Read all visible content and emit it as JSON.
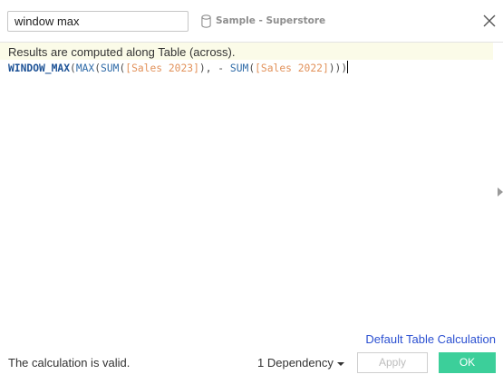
{
  "header": {
    "calc_name": "window max",
    "datasource_icon": "database-icon",
    "datasource_name": "Sample - Superstore",
    "close_icon": "close-icon"
  },
  "info": {
    "message": "Results are computed along Table (across)."
  },
  "formula": {
    "tokens": [
      {
        "text": "WINDOW_MAX",
        "kind": "fn-bold"
      },
      {
        "text": "(",
        "kind": "punct"
      },
      {
        "text": "MAX",
        "kind": "fn"
      },
      {
        "text": "(",
        "kind": "punct"
      },
      {
        "text": "SUM",
        "kind": "fn"
      },
      {
        "text": "(",
        "kind": "punct"
      },
      {
        "text": "[Sales 2023]",
        "kind": "field"
      },
      {
        "text": "), - ",
        "kind": "punct"
      },
      {
        "text": "SUM",
        "kind": "fn"
      },
      {
        "text": "(",
        "kind": "punct"
      },
      {
        "text": "[Sales 2022]",
        "kind": "field"
      },
      {
        "text": ")))",
        "kind": "punct"
      }
    ]
  },
  "footer": {
    "default_link": "Default Table Calculation",
    "status": "The calculation is valid.",
    "dependency_label": "1 Dependency",
    "apply_label": "Apply",
    "ok_label": "OK"
  },
  "colors": {
    "ok_button": "#3ccf9a",
    "link": "#2a4fd1",
    "info_bar": "#fbfbe8",
    "field": "#e2925b",
    "function": "#2f6ba8"
  }
}
